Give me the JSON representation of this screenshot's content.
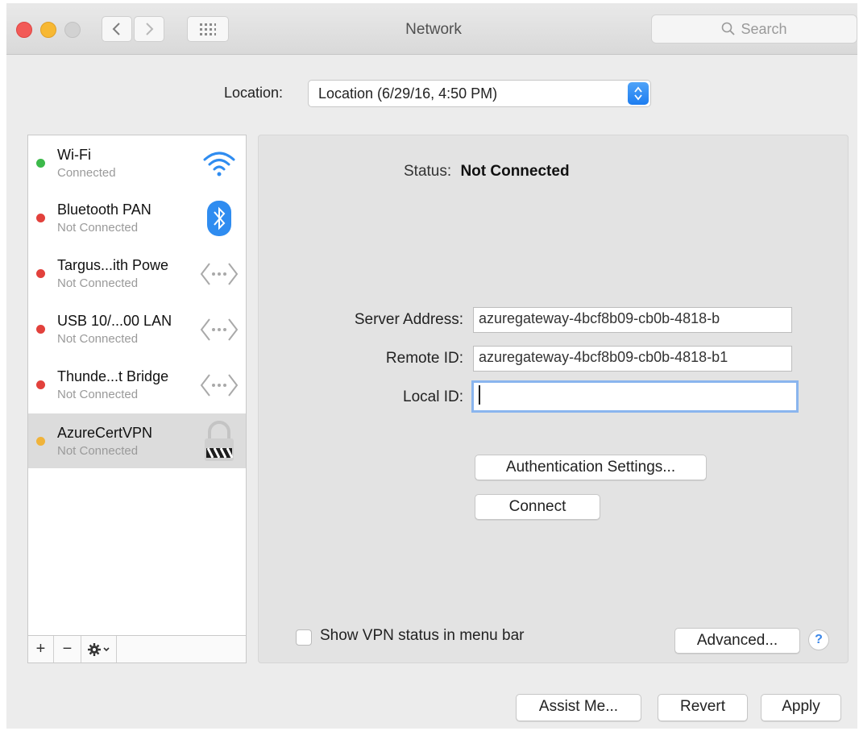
{
  "window": {
    "title": "Network",
    "search_placeholder": "Search"
  },
  "location": {
    "label": "Location:",
    "value": "Location (6/29/16, 4:50 PM)"
  },
  "services": [
    {
      "name": "Wi-Fi",
      "status": "Connected",
      "status_color": "#3cb94a",
      "icon": "wifi-icon"
    },
    {
      "name": "Bluetooth PAN",
      "status": "Not Connected",
      "status_color": "#e2413c",
      "icon": "bluetooth-icon"
    },
    {
      "name": "Targus...ith Powe",
      "status": "Not Connected",
      "status_color": "#e2413c",
      "icon": "ethernet-icon"
    },
    {
      "name": "USB 10/...00 LAN",
      "status": "Not Connected",
      "status_color": "#e2413c",
      "icon": "ethernet-icon"
    },
    {
      "name": "Thunde...t Bridge",
      "status": "Not Connected",
      "status_color": "#e2413c",
      "icon": "ethernet-icon"
    },
    {
      "name": "AzureCertVPN",
      "status": "Not Connected",
      "status_color": "#f0b33a",
      "icon": "vpn-lock-icon",
      "selected": true
    }
  ],
  "sidebar_footer": {
    "add": "+",
    "remove": "−"
  },
  "detail": {
    "status_label": "Status:",
    "status_value": "Not Connected",
    "server_address_label": "Server Address:",
    "server_address_value": "azuregateway-4bcf8b09-cb0b-4818-b",
    "remote_id_label": "Remote ID:",
    "remote_id_value": "azuregateway-4bcf8b09-cb0b-4818-b1",
    "local_id_label": "Local ID:",
    "local_id_value": "",
    "auth_button": "Authentication Settings...",
    "connect_button": "Connect",
    "show_vpn_label": "Show VPN status in menu bar",
    "show_vpn_checked": false,
    "advanced_button": "Advanced...",
    "help_label": "?"
  },
  "footer": {
    "assist_button": "Assist Me...",
    "revert_button": "Revert",
    "apply_button": "Apply"
  },
  "colors": {
    "accent": "#1d7df0",
    "focus_ring": "#8ab5ee"
  }
}
